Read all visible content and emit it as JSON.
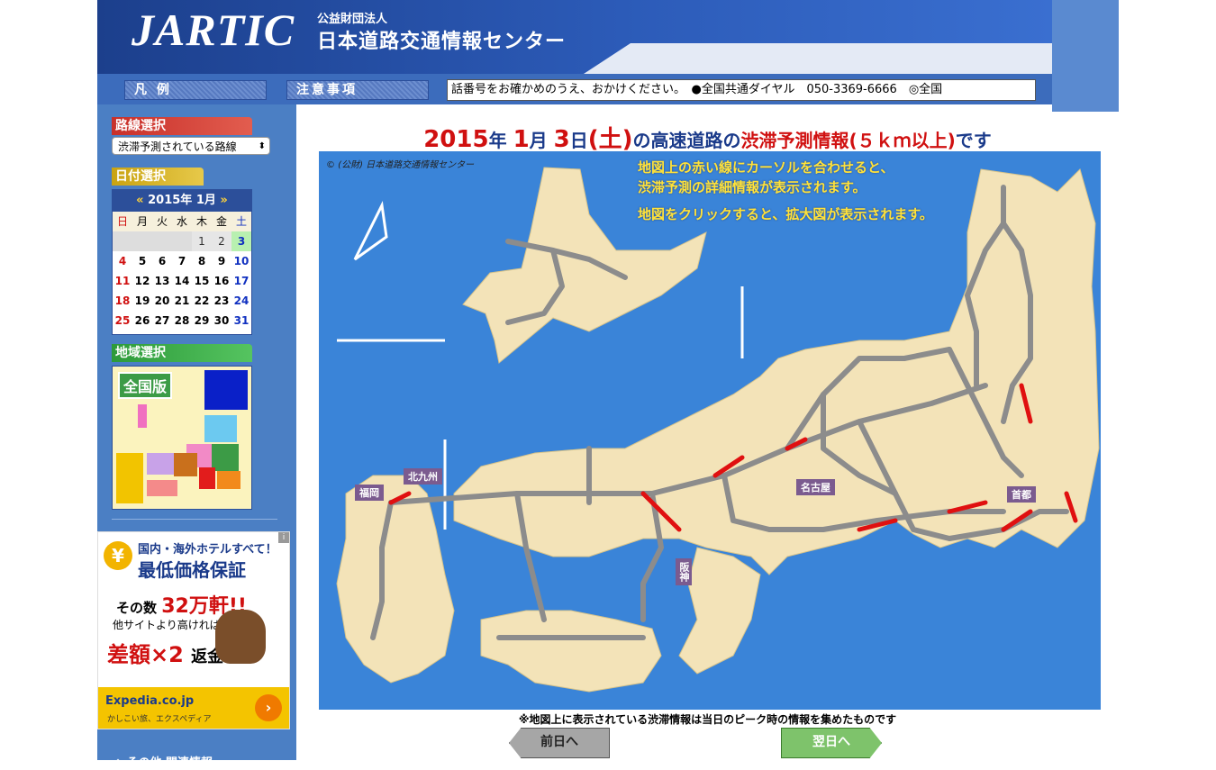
{
  "header": {
    "logo": "JARTIC",
    "org_small": "公益財団法人",
    "org_name": "日本道路交通情報センター"
  },
  "nav": {
    "legend_label": "凡 例",
    "notice_label": "注意事項",
    "ticker": "話番号をお確かめのうえ、おかけください。　●全国共通ダイヤル　050-3369-6666　◎全国"
  },
  "sidebar": {
    "route_heading": "路線選択",
    "route_select": "渋滞予測されている路線",
    "date_heading": "日付選択",
    "calendar": {
      "prev": "«",
      "month": "2015年 1月",
      "next": "»",
      "weekdays": [
        "日",
        "月",
        "火",
        "水",
        "木",
        "金",
        "土"
      ],
      "days": [
        "",
        "",
        "",
        "",
        "1",
        "2",
        "3",
        "4",
        "5",
        "6",
        "7",
        "8",
        "9",
        "10",
        "11",
        "12",
        "13",
        "14",
        "15",
        "16",
        "17",
        "18",
        "19",
        "20",
        "21",
        "22",
        "23",
        "24",
        "25",
        "26",
        "27",
        "28",
        "29",
        "30",
        "31"
      ]
    },
    "region_heading": "地域選択",
    "region_button": "全国版",
    "ad": {
      "line1": "国内・海外ホテルすべて！",
      "line2": "最低価格保証",
      "line3a": "その数",
      "line3b": "32万軒!!",
      "line4": "他サイトより高ければ、",
      "line5a": "差額×2",
      "line5b": "返金",
      "brand": "Expedia.co.jp",
      "brand_sub": "かしこい旅、エクスペディア",
      "info": "i"
    },
    "other_link": "◇ その他 関連情報"
  },
  "main": {
    "title_year": "2015",
    "title_year_unit": "年",
    "title_month": "1",
    "title_month_unit": "月",
    "title_day": "3",
    "title_day_unit": "日",
    "title_weekday": "(土)",
    "title_mid": "の高速道路の",
    "title_red": "渋滞予測情報(５ｋｍ以上)",
    "title_end": "です",
    "map": {
      "copyright": "© (公財) 日本道路交通情報センター",
      "inst1": "地図上の赤い線にカーソルを合わせると、",
      "inst2": "渋滞予測の詳細情報が表示されます。",
      "inst3": "地図をクリックすると、拡大図が表示されます。",
      "regions": {
        "fukuoka": "福岡",
        "kitakyushu": "北九州",
        "nagoya": "名古屋",
        "shuto": "首都",
        "hanshin": "阪神"
      }
    },
    "footnote": "※地図上に表示されている渋滞情報は当日のピーク時の情報を集めたものです",
    "prev_button": "前日へ",
    "next_button": "翌日へ"
  },
  "colors": {
    "accent_blue": "#1a3a8a",
    "congestion_red": "#d01010",
    "sea": "#3a84d8",
    "land": "#f3e3b8"
  }
}
